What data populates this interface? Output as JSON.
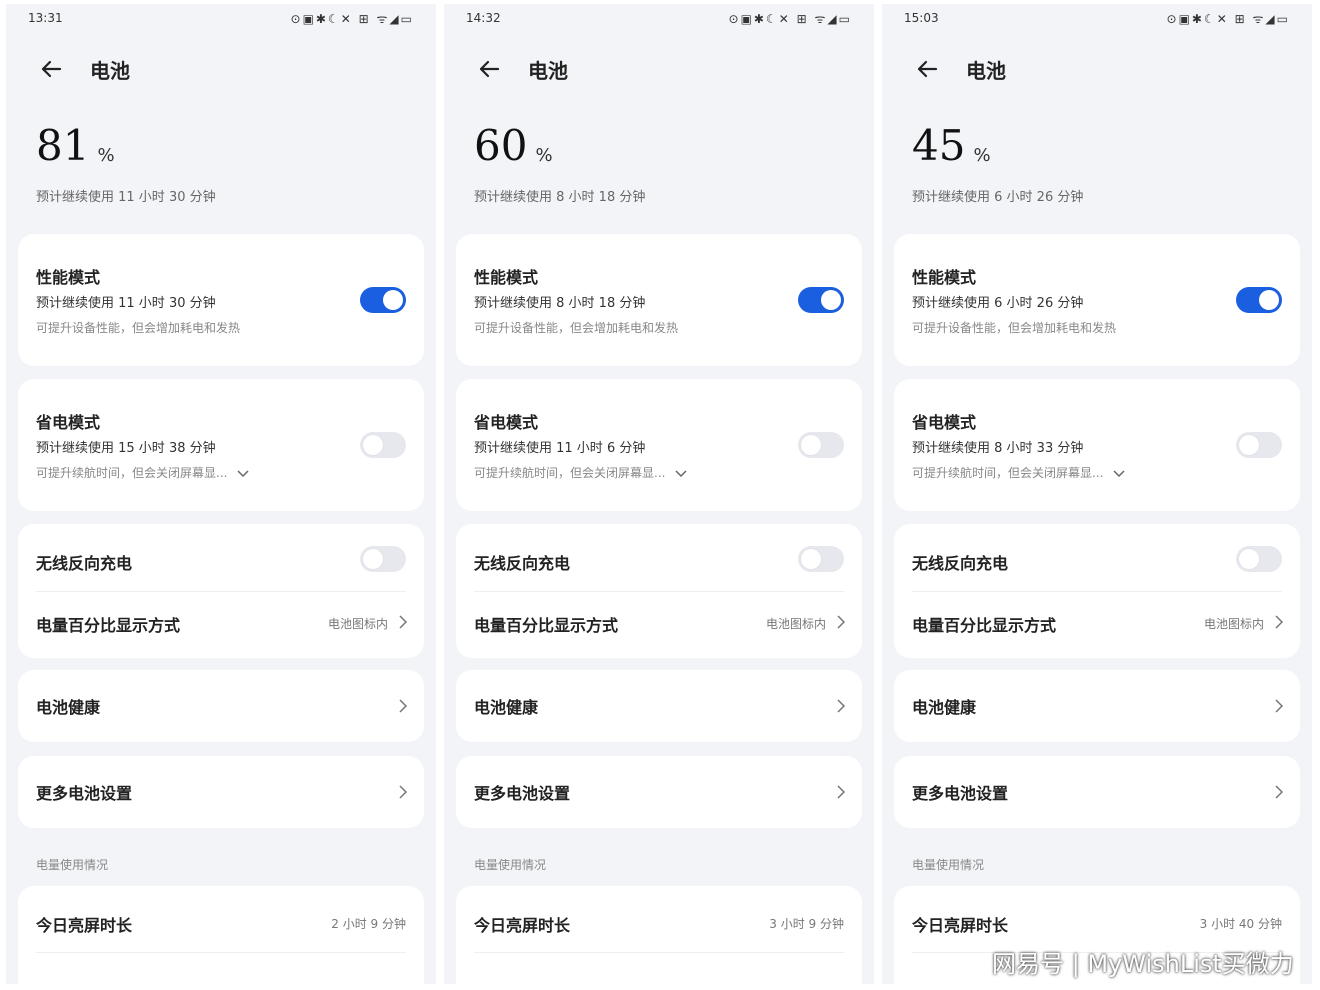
{
  "panels": [
    {
      "status_time": "13:31",
      "status_icons": "⊙▣✱☾✕ ⊞ ᯤ◢▭",
      "title": "电池",
      "percent": "81",
      "percent_unit": "%",
      "estimate": "预计继续使用 11 小时 30 分钟",
      "performance": {
        "title": "性能模式",
        "estimate": "预计继续使用 11 小时 30 分钟",
        "desc": "可提升设备性能，但会增加耗电和发热",
        "enabled": true
      },
      "saver": {
        "title": "省电模式",
        "estimate": "预计继续使用 15 小时 38 分钟",
        "desc": "可提升续航时间，但会关闭屏幕显...",
        "enabled": false
      },
      "wireless": {
        "title": "无线反向充电",
        "enabled": false
      },
      "percent_display": {
        "title": "电量百分比显示方式",
        "value": "电池图标内"
      },
      "health": {
        "title": "电池健康"
      },
      "more": {
        "title": "更多电池设置"
      },
      "usage_label": "电量使用情况",
      "screen_time": {
        "title": "今日亮屏时长",
        "value": "2 小时 9 分钟"
      }
    },
    {
      "status_time": "14:32",
      "status_icons": "⊙▣✱☾✕ ⊞ ᯤ◢▭",
      "title": "电池",
      "percent": "60",
      "percent_unit": "%",
      "estimate": "预计继续使用 8 小时 18 分钟",
      "performance": {
        "title": "性能模式",
        "estimate": "预计继续使用 8 小时 18 分钟",
        "desc": "可提升设备性能，但会增加耗电和发热",
        "enabled": true
      },
      "saver": {
        "title": "省电模式",
        "estimate": "预计继续使用 11 小时 6 分钟",
        "desc": "可提升续航时间，但会关闭屏幕显...",
        "enabled": false
      },
      "wireless": {
        "title": "无线反向充电",
        "enabled": false
      },
      "percent_display": {
        "title": "电量百分比显示方式",
        "value": "电池图标内"
      },
      "health": {
        "title": "电池健康"
      },
      "more": {
        "title": "更多电池设置"
      },
      "usage_label": "电量使用情况",
      "screen_time": {
        "title": "今日亮屏时长",
        "value": "3 小时 9 分钟"
      }
    },
    {
      "status_time": "15:03",
      "status_icons": "⊙▣✱☾✕ ⊞ ᯤ◢▭",
      "title": "电池",
      "percent": "45",
      "percent_unit": "%",
      "estimate": "预计继续使用 6 小时 26 分钟",
      "performance": {
        "title": "性能模式",
        "estimate": "预计继续使用 6 小时 26 分钟",
        "desc": "可提升设备性能，但会增加耗电和发热",
        "enabled": true
      },
      "saver": {
        "title": "省电模式",
        "estimate": "预计继续使用 8 小时 33 分钟",
        "desc": "可提升续航时间，但会关闭屏幕显...",
        "enabled": false
      },
      "wireless": {
        "title": "无线反向充电",
        "enabled": false
      },
      "percent_display": {
        "title": "电量百分比显示方式",
        "value": "电池图标内"
      },
      "health": {
        "title": "电池健康"
      },
      "more": {
        "title": "更多电池设置"
      },
      "usage_label": "电量使用情况",
      "screen_time": {
        "title": "今日亮屏时长",
        "value": "3 小时 40 分钟"
      }
    }
  ],
  "watermark": "网易号 | MyWishList买微力",
  "colors": {
    "toggle_on": "#1a5fe0",
    "background": "#f3f4f8",
    "card": "#ffffff"
  }
}
